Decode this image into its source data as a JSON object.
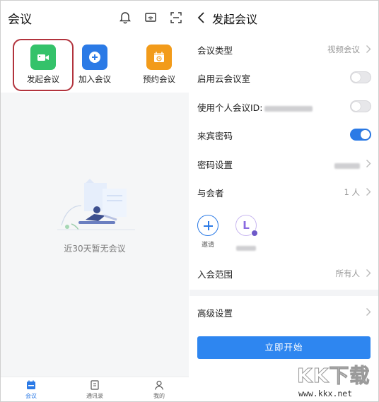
{
  "left": {
    "title": "会议",
    "header_icons": [
      "bell-icon",
      "screen-cast-icon",
      "scan-icon"
    ],
    "quick_actions": [
      {
        "label": "发起会议",
        "icon": "video-camera-icon",
        "color": "#34c26a"
      },
      {
        "label": "加入会议",
        "icon": "plus-circle-icon",
        "color": "#2b7ae6"
      },
      {
        "label": "预约会议",
        "icon": "calendar-clock-icon",
        "color": "#f29b1a"
      }
    ],
    "empty_text": "近30天暂无会议",
    "bottom_nav": [
      {
        "label": "会议",
        "icon": "meeting-calendar-icon"
      },
      {
        "label": "通讯录",
        "icon": "contacts-icon"
      },
      {
        "label": "我的",
        "icon": "profile-icon"
      }
    ]
  },
  "right": {
    "title": "发起会议",
    "rows": {
      "meeting_type": {
        "label": "会议类型",
        "value": "视频会议"
      },
      "cloud_room": {
        "label": "启用云会议室",
        "toggle": false
      },
      "personal_id": {
        "label": "使用个人会议ID:",
        "toggle": false
      },
      "guest_password": {
        "label": "来宾密码",
        "toggle": true
      },
      "password_setting": {
        "label": "密码设置"
      },
      "participants": {
        "label": "与会者",
        "value": "1 人"
      },
      "join_scope": {
        "label": "入会范围",
        "value": "所有人"
      },
      "advanced": {
        "label": "高级设置"
      }
    },
    "invite_label": "邀请",
    "member_initial": "L",
    "start_button": "立即开始"
  },
  "watermark": {
    "brand": "KK下载",
    "url": "www.kkx.net"
  },
  "colors": {
    "accent": "#2b7ae6",
    "highlight_border": "#b2333d"
  }
}
